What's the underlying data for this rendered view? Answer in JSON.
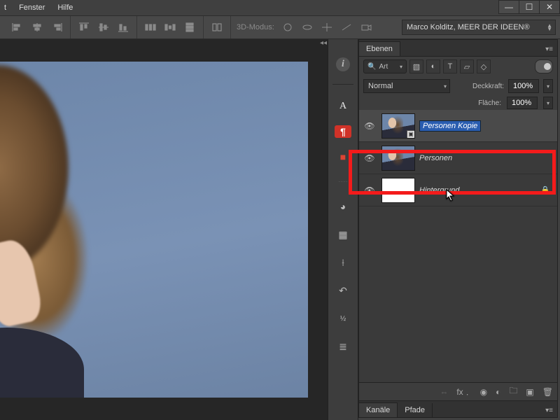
{
  "menu": {
    "items": [
      "t",
      "Fenster",
      "Hilfe"
    ]
  },
  "window_controls": {
    "min": "—",
    "max": "☐",
    "close": "✕"
  },
  "optionsbar": {
    "mode3d_label": "3D-Modus:",
    "workspace": "Marco Kolditz, MEER DER IDEEN®"
  },
  "gutter": {
    "collapse": "◂◂",
    "info": "i",
    "char": "A",
    "para": "¶",
    "swatch": "■",
    "sep": "·····",
    "color": "◕",
    "grid": "▦",
    "ruler": "⟊",
    "history": "↶",
    "actions": "⚙"
  },
  "layers_panel": {
    "tab": "Ebenen",
    "menu_glyph": "▾≡",
    "search_label": "Art",
    "search_glyph": "🔍",
    "filter_icons": {
      "image": "▧",
      "adjust": "◐",
      "text": "T",
      "shape": "▱",
      "smart": "◇"
    },
    "blend_mode": "Normal",
    "opacity_label": "Deckkraft:",
    "opacity_value": "100%",
    "fill_label": "Fläche:",
    "fill_value": "100%",
    "layers": [
      {
        "name": "Personen Kopie",
        "editing": true,
        "smart": true,
        "locked": false
      },
      {
        "name": "Personen",
        "editing": false,
        "smart": false,
        "locked": false
      },
      {
        "name": "Hintergrund",
        "editing": false,
        "smart": false,
        "locked": true,
        "blank": true
      }
    ],
    "eye_glyph": "👁",
    "lock_glyph": "🔒",
    "smart_glyph": "▣",
    "footer": {
      "link": "⇔",
      "fx": "fx﹒",
      "mask": "◉",
      "adjust": "◐",
      "group": "🗀",
      "new": "▣",
      "trash": "🗑"
    }
  },
  "bottom_tabs": {
    "kanaele": "Kanäle",
    "pfade": "Pfade"
  }
}
